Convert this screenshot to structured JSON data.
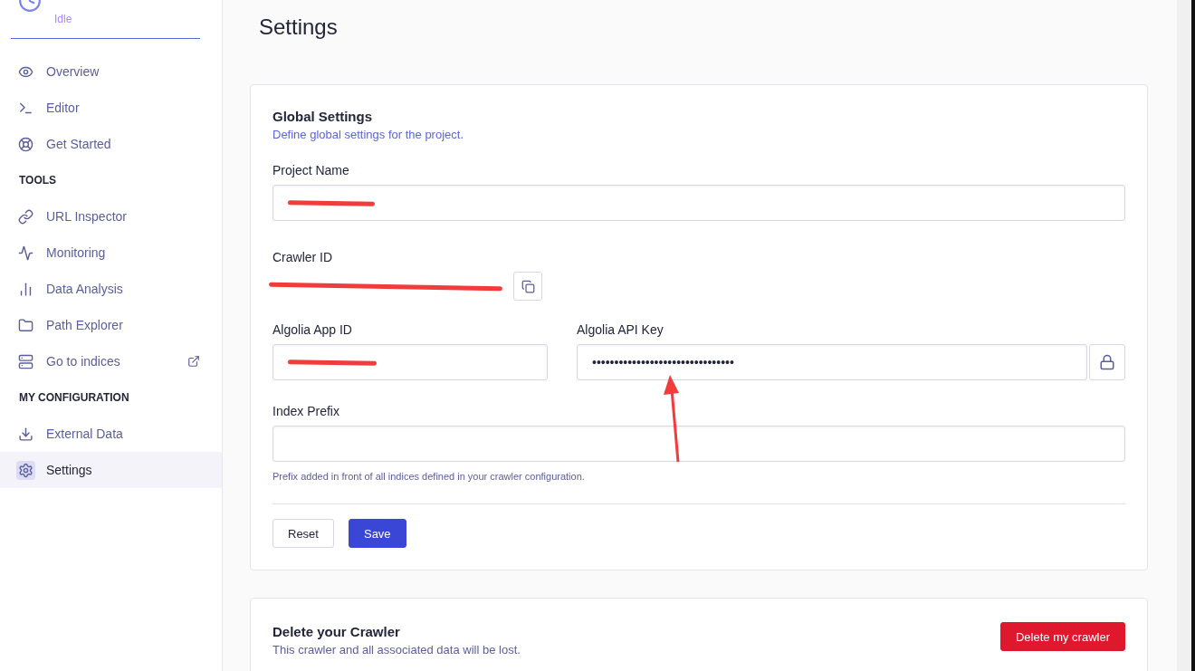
{
  "sidebar": {
    "status": "Idle",
    "items": [
      {
        "kind": "link",
        "label": "Overview",
        "selected": false
      },
      {
        "kind": "link",
        "label": "Editor",
        "selected": false
      },
      {
        "kind": "link",
        "label": "Get Started",
        "selected": false
      },
      {
        "kind": "heading",
        "label": "TOOLS"
      },
      {
        "kind": "link",
        "label": "URL Inspector",
        "selected": false
      },
      {
        "kind": "link",
        "label": "Monitoring",
        "selected": false
      },
      {
        "kind": "link",
        "label": "Data Analysis",
        "selected": false
      },
      {
        "kind": "link",
        "label": "Path Explorer",
        "selected": false
      },
      {
        "kind": "link",
        "label": "Go to indices",
        "selected": false,
        "external": true
      },
      {
        "kind": "heading",
        "label": "MY CONFIGURATION"
      },
      {
        "kind": "link",
        "label": "External Data",
        "selected": false
      },
      {
        "kind": "link",
        "label": "Settings",
        "selected": true
      }
    ]
  },
  "page": {
    "title": "Settings"
  },
  "global_settings": {
    "title": "Global Settings",
    "subtitle": "Define global settings for the project.",
    "project_name": {
      "label": "Project Name"
    },
    "crawler_id": {
      "label": "Crawler ID"
    },
    "app_id": {
      "label": "Algolia App ID"
    },
    "api_key": {
      "label": "Algolia API Key",
      "value": "••••••••••••••••••••••••••••••••"
    },
    "index_prefix": {
      "label": "Index Prefix",
      "help": "Prefix added in front of all indices defined in your crawler configuration."
    },
    "buttons": [
      {
        "kind": "secondary",
        "label": "Reset"
      },
      {
        "kind": "primary",
        "label": "Save"
      }
    ]
  },
  "delete_section": {
    "title": "Delete your Crawler",
    "subtitle": "This crawler and all associated data will be lost.",
    "button": "Delete my crawler"
  }
}
